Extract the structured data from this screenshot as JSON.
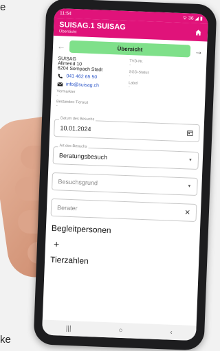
{
  "background": {
    "top_text": "e",
    "bottom_text": "ke"
  },
  "status_bar": {
    "time": "11:54",
    "right_text": "ᯤ 36 ◢ ▮"
  },
  "app_bar": {
    "title": "SUISAG.1 SUISAG",
    "subtitle": "Übersicht"
  },
  "nav": {
    "pill_label": "Übersicht"
  },
  "info": {
    "name": "SUISAG",
    "street": "Allmend 10",
    "city": "6204 Sempach Stadt",
    "phone": "041 462 65 50",
    "email": "info@suisag.ch",
    "vermarkter_label": "Vermarkter",
    "vermarkter_value": "-",
    "tierarzt_label": "Bestandes-Tierarzt",
    "tierarzt_value": "-",
    "tvd_label": "TVD-Nr.",
    "tvd_value": "-",
    "sgd_label": "SGD-Status",
    "sgd_value": "-",
    "label_label": "Label",
    "label_value": "-"
  },
  "form": {
    "date_label": "Datum des Besuchs",
    "date_value": "10.01.2024",
    "art_label": "Art des Besuchs",
    "art_value": "Beratungsbesuch",
    "grund_placeholder": "Besuchsgrund",
    "berater_placeholder": "Berater"
  },
  "sections": {
    "begleit": "Begleitpersonen",
    "add": "+",
    "tierzahlen": "Tierzahlen"
  },
  "colors": {
    "accent": "#e0137a",
    "pill": "#7fe08a",
    "link": "#2f58c9"
  }
}
